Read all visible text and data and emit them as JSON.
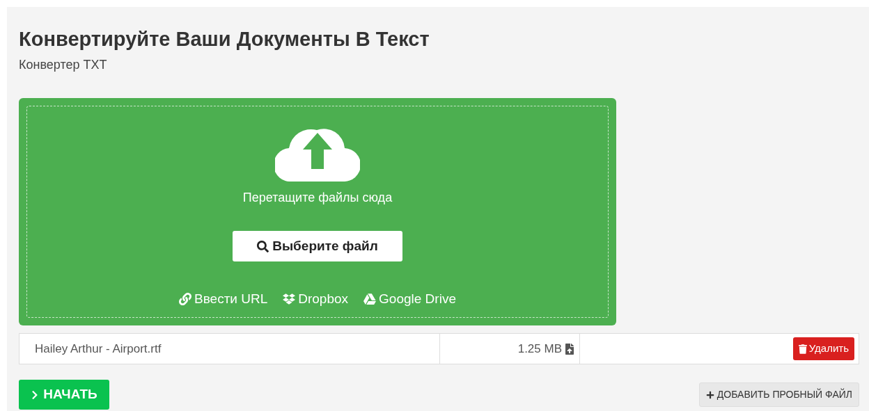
{
  "header": {
    "title": "Конвертируйте Ваши Документы В Текст",
    "subtitle": "Конвертер TXT"
  },
  "dropzone": {
    "prompt": "Перетащите файлы сюда",
    "choose_button": "Выберите файл",
    "sources": [
      {
        "kind": "url",
        "label": "Ввести URL"
      },
      {
        "kind": "dropbox",
        "label": "Dropbox"
      },
      {
        "kind": "drive",
        "label": "Google Drive"
      }
    ]
  },
  "files": [
    {
      "name": "Hailey Arthur - Airport.rtf",
      "size": "1.25 MB",
      "delete_button": "Удалить"
    }
  ],
  "start_button": "НАЧАТЬ",
  "sample_button": "ДОБАВИТЬ ПРОБНЫЙ ФАЙЛ"
}
